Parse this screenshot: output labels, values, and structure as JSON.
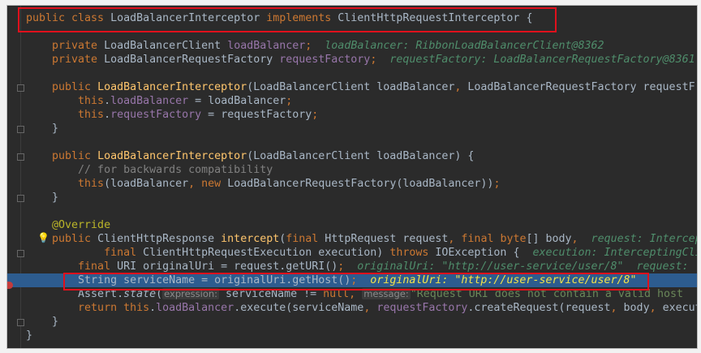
{
  "lines": [
    [
      [
        "public class ",
        "kw"
      ],
      [
        "LoadBalancerInterceptor ",
        ""
      ],
      [
        "implements ",
        "kw"
      ],
      [
        "ClientHttpRequestInterceptor {",
        ""
      ]
    ],
    [],
    [
      [
        "    private ",
        "kw"
      ],
      [
        "LoadBalancerClient ",
        ""
      ],
      [
        "loadBalancer",
        "fld"
      ],
      [
        ";",
        "kw"
      ],
      [
        "  loadBalancer: RibbonLoadBalancerClient@8362",
        "hint"
      ]
    ],
    [
      [
        "    private ",
        "kw"
      ],
      [
        "LoadBalancerRequestFactory ",
        ""
      ],
      [
        "requestFactory",
        "fld"
      ],
      [
        ";",
        "kw"
      ],
      [
        "  requestFactory: LoadBalancerRequestFactory@8361",
        "hint"
      ]
    ],
    [],
    [
      [
        "    public ",
        "kw"
      ],
      [
        "LoadBalancerInterceptor",
        "mth"
      ],
      [
        "(LoadBalancerClient loadBalancer",
        ""
      ],
      [
        ", ",
        "kw"
      ],
      [
        "LoadBalancerRequestFactory requestF",
        ""
      ]
    ],
    [
      [
        "        this",
        "kw"
      ],
      [
        ".",
        ""
      ],
      [
        "loadBalancer",
        "fld"
      ],
      [
        " = loadBalancer",
        ""
      ],
      [
        ";",
        "kw"
      ]
    ],
    [
      [
        "        this",
        "kw"
      ],
      [
        ".",
        ""
      ],
      [
        "requestFactory",
        "fld"
      ],
      [
        " = requestFactory",
        ""
      ],
      [
        ";",
        "kw"
      ]
    ],
    [
      [
        "    }",
        ""
      ]
    ],
    [],
    [
      [
        "    public ",
        "kw"
      ],
      [
        "LoadBalancerInterceptor",
        "mth"
      ],
      [
        "(LoadBalancerClient loadBalancer) {",
        ""
      ]
    ],
    [
      [
        "        // for backwards compatibility",
        "cmt"
      ]
    ],
    [
      [
        "        this",
        "kw"
      ],
      [
        "(loadBalancer",
        ""
      ],
      [
        ", ",
        "kw"
      ],
      [
        "new ",
        "kw"
      ],
      [
        "LoadBalancerRequestFactory(loadBalancer))",
        ""
      ],
      [
        ";",
        "kw"
      ]
    ],
    [
      [
        "    }",
        ""
      ]
    ],
    [],
    [
      [
        "    @Override",
        "ann"
      ]
    ],
    [
      [
        "    public ",
        "kw"
      ],
      [
        "ClientHttpResponse ",
        ""
      ],
      [
        "intercept",
        "mth"
      ],
      [
        "(",
        ""
      ],
      [
        "final ",
        "kw"
      ],
      [
        "HttpRequest request",
        ""
      ],
      [
        ", ",
        "kw"
      ],
      [
        "final byte",
        "kw"
      ],
      [
        "[] body",
        ""
      ],
      [
        ",",
        "kw"
      ],
      [
        "  request: InterceptingClientHttpRequest",
        "hint"
      ]
    ],
    [
      [
        "            final ",
        "kw"
      ],
      [
        "ClientHttpRequestExecution execution) ",
        ""
      ],
      [
        "throws ",
        "kw"
      ],
      [
        "IOException {",
        ""
      ],
      [
        "  execution: InterceptingClientHttpRequest",
        "hint"
      ]
    ],
    [
      [
        "        final ",
        "kw"
      ],
      [
        "URI originalUri = request.getURI()",
        ""
      ],
      [
        ";",
        "kw"
      ],
      [
        "  originalUri: \"http://user-service/user/8\"  request: ",
        "hint"
      ]
    ],
    [
      [
        "        String serviceName = originalUri.getHost()",
        ""
      ],
      [
        ";",
        "kw"
      ],
      [
        "  originalUri: \"http://user-service/user/8\"",
        "hintsel"
      ]
    ],
    [
      [
        "        Assert.",
        ""
      ],
      [
        "state",
        "it"
      ],
      [
        "(",
        ""
      ],
      [
        "expression:",
        "ph"
      ],
      [
        " serviceName != ",
        ""
      ],
      [
        "null",
        "kw"
      ],
      [
        ", ",
        "kw"
      ],
      [
        "message:",
        "ph"
      ],
      [
        "\"Request URI does not contain a valid host",
        "str"
      ]
    ],
    [
      [
        "        return this",
        "kw"
      ],
      [
        ".",
        ""
      ],
      [
        "loadBalancer",
        "fld"
      ],
      [
        ".execute(serviceName",
        ""
      ],
      [
        ", ",
        "kw"
      ],
      [
        "requestFactory",
        "fld"
      ],
      [
        ".createRequest(request",
        ""
      ],
      [
        ", ",
        "kw"
      ],
      [
        "body",
        ""
      ],
      [
        ", ",
        "kw"
      ],
      [
        "execution",
        ""
      ]
    ],
    [
      [
        "    }",
        ""
      ]
    ],
    [
      [
        "}",
        ""
      ]
    ]
  ],
  "selected_line": 19
}
